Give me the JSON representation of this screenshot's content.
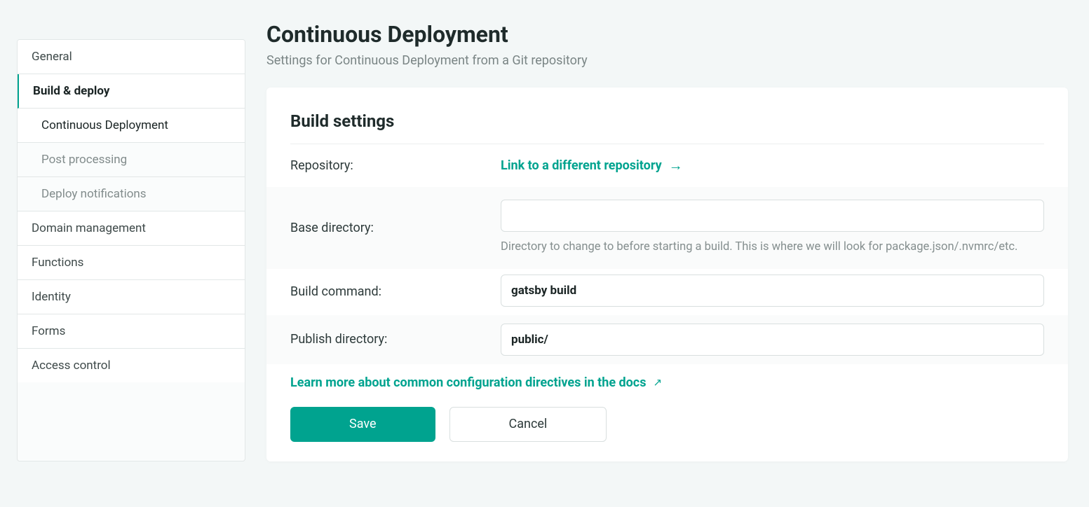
{
  "sidebar": {
    "general": "General",
    "build_deploy": "Build & deploy",
    "sub_continuous": "Continuous Deployment",
    "sub_post": "Post processing",
    "sub_notifications": "Deploy notifications",
    "domain": "Domain management",
    "functions": "Functions",
    "identity": "Identity",
    "forms": "Forms",
    "access": "Access control"
  },
  "page": {
    "title": "Continuous Deployment",
    "subtitle": "Settings for Continuous Deployment from a Git repository"
  },
  "panel": {
    "title": "Build settings",
    "repo_label": "Repository:",
    "repo_link": "Link to a different repository",
    "base_label": "Base directory:",
    "base_value": "",
    "base_help": "Directory to change to before starting a build. This is where we will look for package.json/.nvmrc/etc.",
    "cmd_label": "Build command:",
    "cmd_value": "gatsby build",
    "pub_label": "Publish directory:",
    "pub_value": "public/",
    "docs_link": "Learn more about common configuration directives in the docs",
    "save": "Save",
    "cancel": "Cancel"
  }
}
